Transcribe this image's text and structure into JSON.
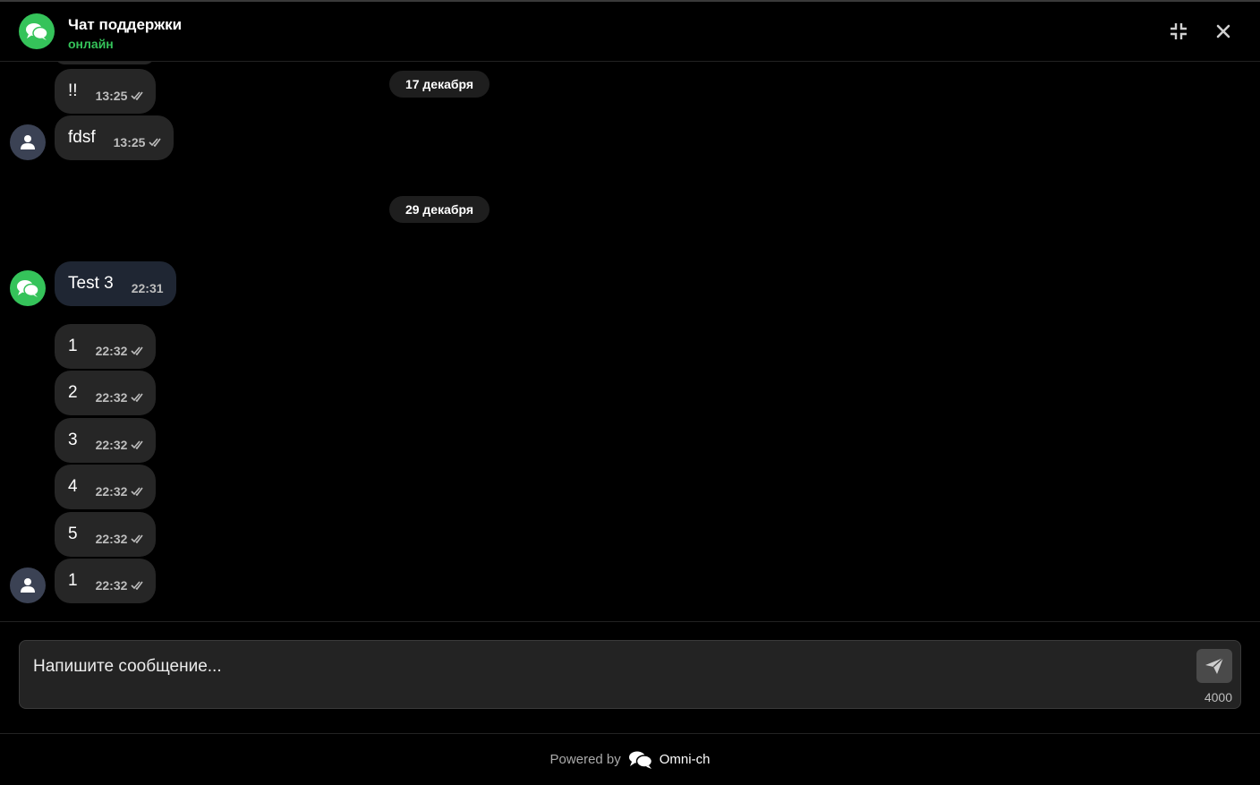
{
  "header": {
    "title": "Чат поддержки",
    "status": "онлайн"
  },
  "dates": [
    "17 декабря",
    "29 декабря"
  ],
  "messages": [
    {
      "text": "!!",
      "time": "13:25"
    },
    {
      "text": "fdsf",
      "time": "13:25"
    },
    {
      "text": "Test 3",
      "time": "22:31"
    },
    {
      "text": "1",
      "time": "22:32"
    },
    {
      "text": "2",
      "time": "22:32"
    },
    {
      "text": "3",
      "time": "22:32"
    },
    {
      "text": "4",
      "time": "22:32"
    },
    {
      "text": "5",
      "time": "22:32"
    },
    {
      "text": "1",
      "time": "22:32"
    }
  ],
  "composer": {
    "placeholder": "Напишите сообщение...",
    "counter": "4000"
  },
  "footer": {
    "powered_by": "Powered by",
    "brand": "Omni-ch"
  },
  "colors": {
    "accent": "#35c35a",
    "user_bubble": "#262626",
    "support_bubble": "#1f2633"
  }
}
